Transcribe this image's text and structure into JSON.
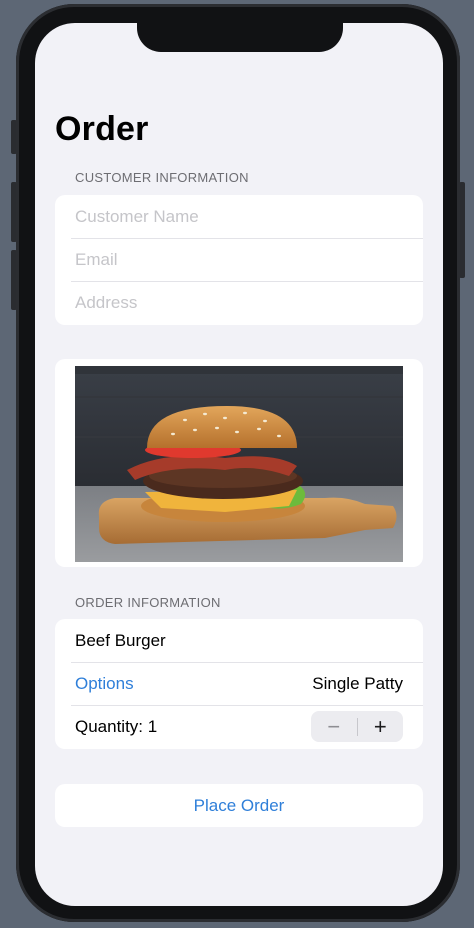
{
  "page": {
    "title": "Order"
  },
  "customer_section": {
    "header": "CUSTOMER INFORMATION",
    "fields": [
      {
        "placeholder": "Customer Name",
        "value": ""
      },
      {
        "placeholder": "Email",
        "value": ""
      },
      {
        "placeholder": "Address",
        "value": ""
      }
    ]
  },
  "product_image": {
    "icon": "burger-photo"
  },
  "order_section": {
    "header": "ORDER INFORMATION",
    "item_name": "Beef Burger",
    "options_label": "Options",
    "options_value": "Single Patty",
    "quantity_label": "Quantity: 1",
    "stepper": {
      "minus": "−",
      "plus": "+"
    }
  },
  "actions": {
    "place_order_label": "Place Order"
  },
  "colors": {
    "accent": "#2f7fd9",
    "background": "#f2f2f7",
    "card": "#ffffff",
    "frame": "#111214"
  }
}
